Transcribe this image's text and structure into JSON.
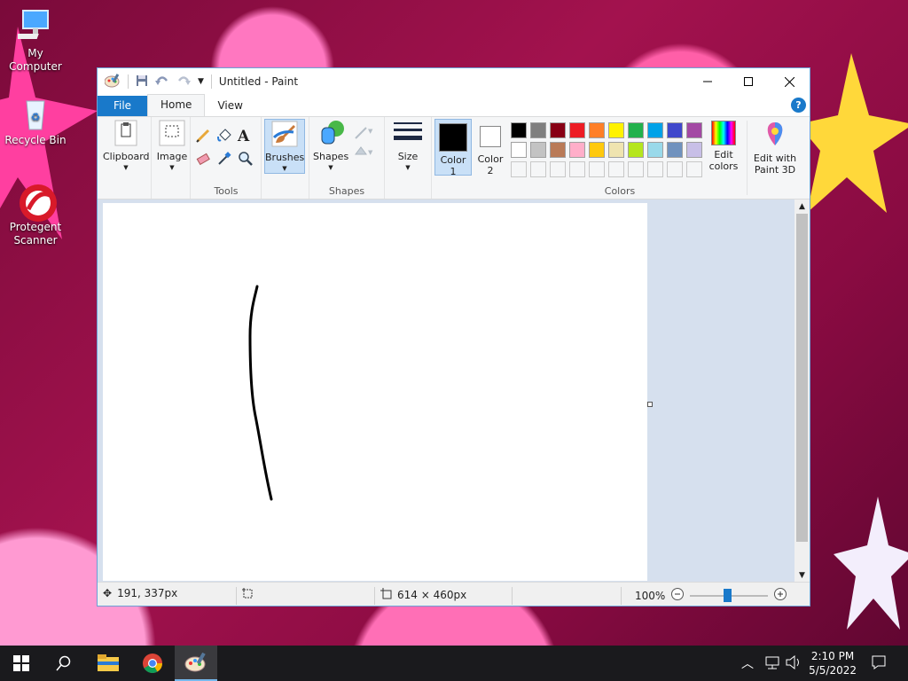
{
  "desktop": {
    "icons": [
      {
        "label": "My Computer"
      },
      {
        "label": "Recycle Bin"
      },
      {
        "label": "Protegent Scanner"
      }
    ]
  },
  "window": {
    "title": "Untitled - Paint",
    "tabs": {
      "file": "File",
      "home": "Home",
      "view": "View"
    },
    "help": "?"
  },
  "ribbon": {
    "clipboard": "Clipboard",
    "image": "Image",
    "tools_group": "Tools",
    "brushes": "Brushes",
    "shapes": "Shapes",
    "shapes_group": "Shapes",
    "size": "Size",
    "color1": "Color\n1",
    "color2": "Color\n2",
    "colors_group": "Colors",
    "edit_colors": "Edit colors",
    "edit_paint3d": "Edit with Paint 3D",
    "text_tool": "A",
    "palette_row1": [
      "#000000",
      "#7f7f7f",
      "#880015",
      "#ed1c24",
      "#ff7f27",
      "#fff200",
      "#22b14c",
      "#00a2e8",
      "#3f48cc",
      "#a349a4"
    ],
    "palette_row2": [
      "#ffffff",
      "#c3c3c3",
      "#b97a57",
      "#ffaec9",
      "#ffc90e",
      "#efe4b0",
      "#b5e61d",
      "#99d9ea",
      "#7092be",
      "#c8bfe7"
    ]
  },
  "status": {
    "cursor_pos": "191, 337px",
    "canvas_size": "614 × 460px",
    "zoom": "100%"
  },
  "taskbar": {
    "time": "2:10 PM",
    "date": "5/5/2022"
  }
}
